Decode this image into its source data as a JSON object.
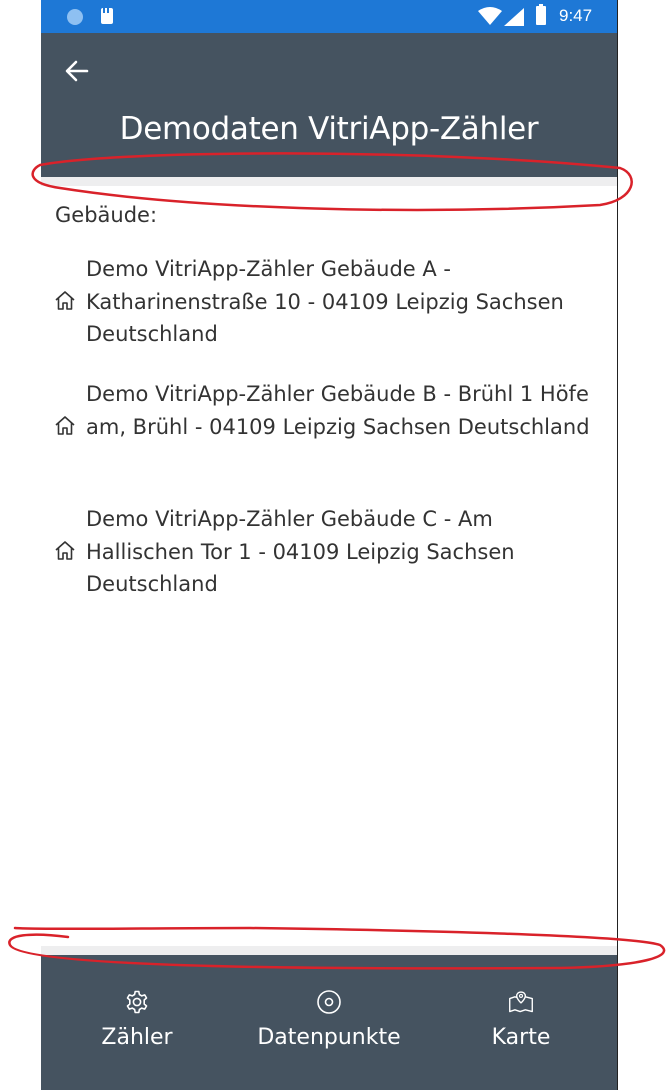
{
  "status_bar": {
    "time": "9:47"
  },
  "header": {
    "title": "Demodaten VitriApp-Zähler"
  },
  "content": {
    "section_label": "Gebäude:",
    "buildings": [
      {
        "label": "Demo VitriApp-Zähler Gebäude A - Katharinenstraße 10 - 04109 Leipzig Sachsen Deutschland"
      },
      {
        "label": "Demo VitriApp-Zähler Gebäude B - Brühl 1 Höfe am, Brühl - 04109 Leipzig Sachsen Deutschland"
      },
      {
        "label": "Demo VitriApp-Zähler Gebäude C - Am Hallischen Tor 1 - 04109 Leipzig Sachsen Deutschland"
      }
    ]
  },
  "bottom_nav": {
    "tabs": [
      {
        "label": "Zähler",
        "icon": "gear-icon"
      },
      {
        "label": "Datenpunkte",
        "icon": "target-icon"
      },
      {
        "label": "Karte",
        "icon": "map-icon"
      }
    ]
  },
  "colors": {
    "status_bar": "#1e78d6",
    "app_bar": "#455360",
    "annotation": "#d9222a"
  }
}
